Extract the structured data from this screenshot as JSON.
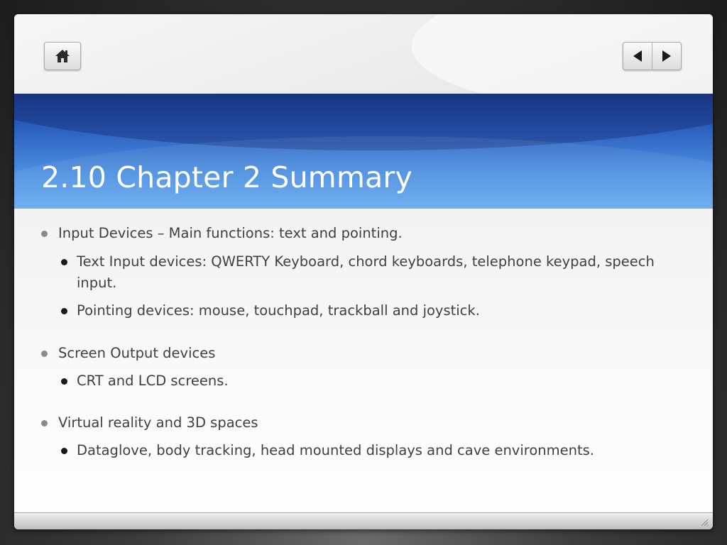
{
  "slide": {
    "title": "2.10 Chapter 2 Summary",
    "bullets": [
      {
        "text": "Input Devices – Main functions: text and pointing.",
        "children": [
          "Text Input devices: QWERTY Keyboard, chord keyboards, telephone keypad, speech input.",
          "Pointing devices: mouse, touchpad, trackball and joystick."
        ]
      },
      {
        "text": "Screen Output devices",
        "children": [
          "CRT and LCD screens."
        ]
      },
      {
        "text": "Virtual reality and 3D spaces",
        "children": [
          "Dataglove, body tracking, head mounted displays and cave environments."
        ]
      }
    ]
  },
  "nav": {
    "home_icon": "home-icon",
    "prev_icon": "triangle-left-icon",
    "next_icon": "triangle-right-icon"
  },
  "colors": {
    "title_band_top": "#1e3e8f",
    "title_band_bottom": "#66aaf0",
    "title_text": "#ffffff",
    "body_text": "#404040"
  }
}
